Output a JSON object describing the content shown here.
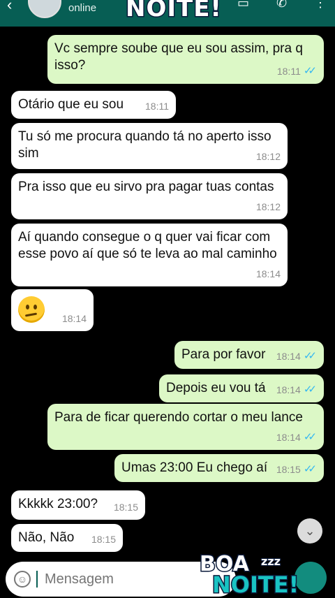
{
  "header": {
    "status": "online",
    "sticker_text": "NOITE!"
  },
  "messages": [
    {
      "dir": "out",
      "text": "Vc sempre soube que eu sou assim, pra q isso?",
      "time": "18:11",
      "read": true
    },
    {
      "dir": "in",
      "text": "Otário que eu sou",
      "time": "18:11"
    },
    {
      "dir": "in",
      "text": "Tu só me procura quando tá no aperto isso sim",
      "time": "18:12"
    },
    {
      "dir": "in",
      "text": "Pra isso que eu sirvo pra pagar tuas contas",
      "time": "18:12"
    },
    {
      "dir": "in",
      "text": "Aí quando consegue o q quer vai ficar com esse povo aí que só te leva ao mal caminho",
      "time": "18:14"
    },
    {
      "dir": "in",
      "emoji": "confused-face",
      "time": "18:14"
    },
    {
      "dir": "out",
      "text": "Para por favor",
      "time": "18:14",
      "read": true
    },
    {
      "dir": "out",
      "text": "Depois eu vou tá",
      "time": "18:14",
      "read": true
    },
    {
      "dir": "out",
      "text": "Para de ficar querendo cortar o meu lance",
      "time": "18:14",
      "read": true
    },
    {
      "dir": "out",
      "text": "Umas 23:00 Eu chego aí",
      "time": "18:15",
      "read": true
    },
    {
      "dir": "in",
      "text": "Kkkkk 23:00?",
      "time": "18:15"
    },
    {
      "dir": "in",
      "text": "Não, Não",
      "time": "18:15"
    }
  ],
  "composer": {
    "placeholder": "Mensagem"
  },
  "sticker_bottom": {
    "line1": "BOA",
    "zzz": "zzz",
    "line2": "NOITE!"
  },
  "colors": {
    "header": "#075e54",
    "outgoing_bubble": "#dcf8c6",
    "incoming_bubble": "#ffffff",
    "read_ticks": "#34b7f1",
    "background": "#000000"
  }
}
